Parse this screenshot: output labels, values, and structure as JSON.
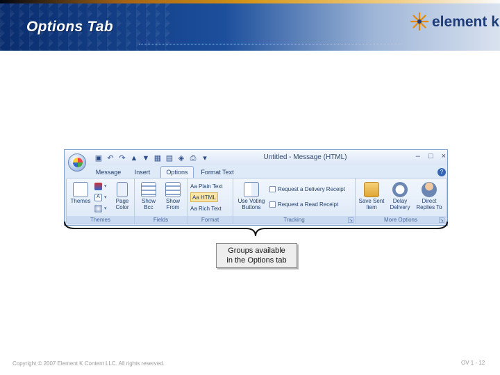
{
  "slide": {
    "title": "Options Tab",
    "brand": "element k",
    "copyright": "Copyright © 2007 Element K Content LLC. All rights reserved.",
    "page_number": "OV 1 - 12"
  },
  "window": {
    "title": "Untitled - Message (HTML)",
    "controls": [
      "–",
      "□",
      "×"
    ],
    "quick_access": [
      "save-icon",
      "undo-icon",
      "redo-icon",
      "up-icon",
      "down-icon",
      "table-icon",
      "picture-icon",
      "attach-icon",
      "print-icon"
    ],
    "tabs": [
      {
        "label": "Message"
      },
      {
        "label": "Insert"
      },
      {
        "label": "Options"
      },
      {
        "label": "Format Text"
      }
    ],
    "active_tab": "Options",
    "help": "?"
  },
  "ribbon": {
    "themes": {
      "label": "Themes",
      "themes_btn": "Themes",
      "page_color": "Page Color"
    },
    "fields": {
      "label": "Fields",
      "show_bcc": "Show Bcc",
      "show_from": "Show From"
    },
    "format": {
      "label": "Format",
      "plain": "Aa Plain Text",
      "html": "Aa HTML",
      "rich": "Aa Rich Text"
    },
    "tracking": {
      "label": "Tracking",
      "use_voting": "Use Voting Buttons",
      "delivery": "Request a Delivery Receipt",
      "read": "Request a Read Receipt"
    },
    "more": {
      "label": "More Options",
      "save_sent": "Save Sent Item",
      "delay": "Delay Delivery",
      "direct": "Direct Replies To"
    }
  },
  "callout": {
    "line1": "Groups available",
    "line2": "in the Options tab"
  },
  "colors": {
    "header_dark": "#0a2d6e",
    "brand": "#1e3c79",
    "ribbon_blue": "#dfeaf8"
  }
}
